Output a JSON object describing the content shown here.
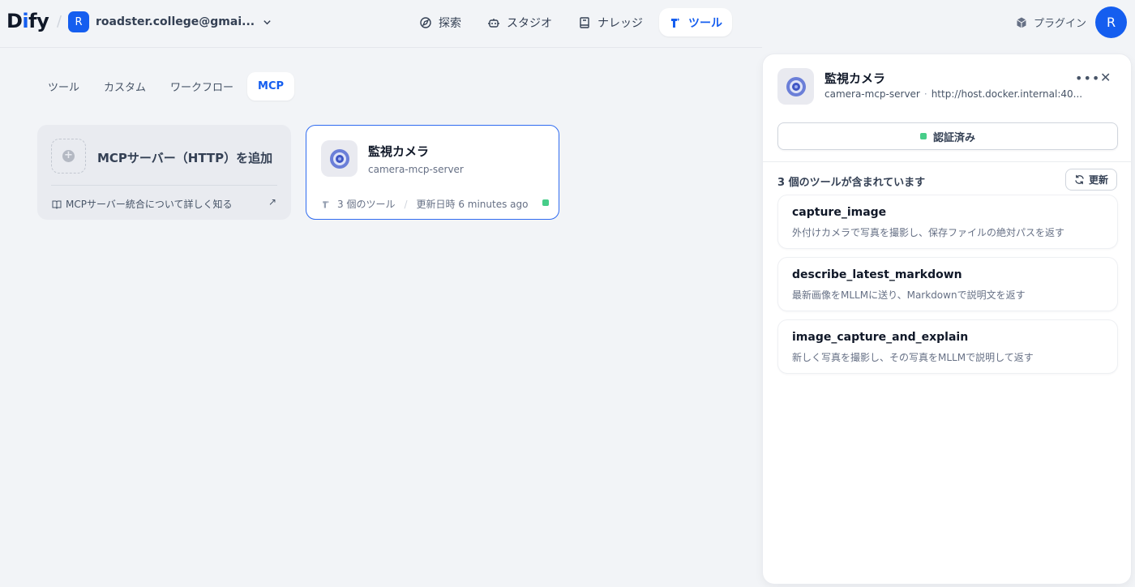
{
  "header": {
    "logo_prefix": "D",
    "logo_i": "i",
    "logo_suffix": "fy",
    "workspace_initial": "R",
    "workspace_name": "roadster.college@gmai...",
    "nav": [
      {
        "label": "探索",
        "icon": "compass-icon"
      },
      {
        "label": "スタジオ",
        "icon": "robot-icon"
      },
      {
        "label": "ナレッジ",
        "icon": "book-icon"
      },
      {
        "label": "ツール",
        "icon": "tool-icon",
        "active": true
      }
    ],
    "plugin_label": "プラグイン",
    "user_initial": "R"
  },
  "tabs": [
    {
      "label": "ツール"
    },
    {
      "label": "カスタム"
    },
    {
      "label": "ワークフロー"
    },
    {
      "label": "MCP",
      "active": true
    }
  ],
  "add_card": {
    "title": "MCPサーバー（HTTP）を追加",
    "link": "MCPサーバー統合について詳しく知る",
    "arrow": "↗"
  },
  "server_card": {
    "title": "監視カメラ",
    "subtitle": "camera-mcp-server",
    "tool_count": "3 個のツール",
    "updated": "更新日時 6 minutes ago"
  },
  "panel": {
    "title": "監視カメラ",
    "server_id": "camera-mcp-server",
    "server_url": "http://host.docker.internal:40...",
    "auth_label": "認証済み",
    "tools_count_label": "3 個のツールが含まれています",
    "refresh_label": "更新",
    "tools": [
      {
        "name": "capture_image",
        "desc": "外付けカメラで写真を撮影し、保存ファイルの絶対パスを返す"
      },
      {
        "name": "describe_latest_markdown",
        "desc": "最新画像をMLLMに送り、Markdownで説明文を返す"
      },
      {
        "name": "image_capture_and_explain",
        "desc": "新しく写真を撮影し、その写真をMLLMで説明して返す"
      }
    ]
  },
  "colors": {
    "accent": "#155eef",
    "status_green": "#47cd89"
  }
}
